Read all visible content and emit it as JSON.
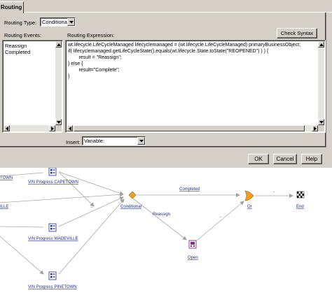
{
  "dialog": {
    "tab_label": "Routing",
    "routing_type_label": "Routing Type:",
    "routing_type_value": "Conditional",
    "routing_events_label": "Routing Events:",
    "routing_expression_label": "Routing Expression:",
    "check_syntax_label": "Check Syntax",
    "routing_events": [
      "Reassign",
      "Completed"
    ],
    "expression_lines": [
      "wt.lifecycle.LifeCycleManaged lifecyclemanaged = (wt.lifecycle.LifeCycleManaged) primaryBusinessObject;",
      "if( lifecyclemanaged.getLifeCycleState().equals(wt.lifecycle.State.toState(\"REOPENED\") ) ) {",
      "        result = \"Reassign\";",
      "} else {",
      "        result=\"Complete\";",
      "}"
    ],
    "insert_label": "Insert:",
    "insert_value": "Variable:",
    "ok_label": "OK",
    "cancel_label": "Cancel",
    "help_label": "Help"
  },
  "diagram": {
    "nodes": {
      "left_top": "TOWN",
      "left_mid": "ILLE",
      "vin_capetown": "VIN Progress CAPETOWN",
      "vin_wadeville": "VIN Progress WADEVILLE",
      "vin_pinetown": "VIN Progress PINETOWN",
      "conditional": "Conditional",
      "open": "Open",
      "or": "Or",
      "end": "End"
    },
    "edges": {
      "completed": "Completed",
      "reassign": "Reassign",
      "dash": "-"
    },
    "colors": {
      "link_text": "#1e2d8a",
      "conditional_diamond": "#f0a020",
      "or_gate": "#f0a020",
      "arrow": "#a0a0a0"
    }
  }
}
